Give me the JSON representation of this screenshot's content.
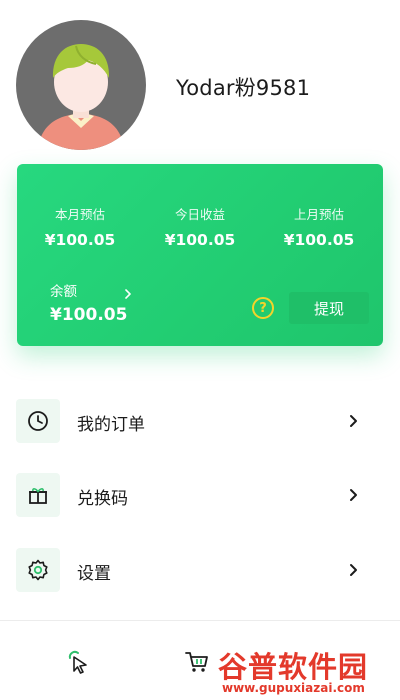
{
  "profile": {
    "username": "Yodar粉9581"
  },
  "earnings": {
    "stats": [
      {
        "label": "本月预估",
        "value": "¥100.05"
      },
      {
        "label": "今日收益",
        "value": "¥100.05"
      },
      {
        "label": "上月预估",
        "value": "¥100.05"
      }
    ],
    "balance_label": "余额",
    "balance_value": "¥100.05",
    "help_symbol": "?",
    "withdraw_label": "提现"
  },
  "menu": {
    "items": [
      {
        "label": "我的订单",
        "icon": "clock-icon"
      },
      {
        "label": "兑换码",
        "icon": "gift-icon"
      },
      {
        "label": "设置",
        "icon": "gear-icon"
      }
    ]
  },
  "tabbar": {
    "icons": [
      "cursor-icon",
      "cart-icon"
    ]
  },
  "watermark": {
    "logo_text": "谷普软件园",
    "url": "www.gupuxiazai.com"
  },
  "colors": {
    "accent": "#22cd72",
    "help_icon": "#f4d42a",
    "watermark": "#e3392b"
  }
}
